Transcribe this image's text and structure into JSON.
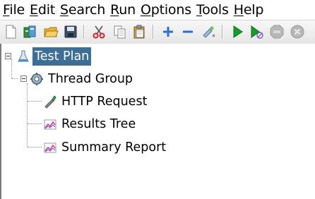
{
  "menu": {
    "items": [
      {
        "mnemonic": "F",
        "rest": "ile"
      },
      {
        "mnemonic": "E",
        "rest": "dit"
      },
      {
        "mnemonic": "S",
        "rest": "earch"
      },
      {
        "mnemonic": "R",
        "rest": "un"
      },
      {
        "mnemonic": "O",
        "rest": "ptions"
      },
      {
        "mnemonic": "T",
        "rest": "ools"
      },
      {
        "mnemonic": "H",
        "rest": "elp"
      }
    ]
  },
  "toolbar": {
    "icons": [
      "new-icon",
      "templates-icon",
      "open-icon",
      "save-icon",
      "cut-icon",
      "copy-icon",
      "paste-icon",
      "expand-icon",
      "collapse-icon",
      "toggle-icon",
      "start-icon",
      "start-no-pause-icon",
      "stop-icon",
      "shutdown-icon"
    ]
  },
  "tree": {
    "nodes": [
      {
        "label": "Test Plan",
        "icon": "test-plan-icon",
        "selected": true
      },
      {
        "label": "Thread Group",
        "icon": "thread-group-icon",
        "selected": false
      },
      {
        "label": "HTTP Request",
        "icon": "http-request-icon",
        "selected": false
      },
      {
        "label": "Results Tree",
        "icon": "results-tree-icon",
        "selected": false
      },
      {
        "label": "Summary Report",
        "icon": "summary-report-icon",
        "selected": false
      }
    ]
  },
  "colors": {
    "selection": "#3c6e96",
    "run_green": "#1a9a2a",
    "toolbar_blue": "#2a6fd6",
    "disabled_gray": "#b8b8b8"
  }
}
